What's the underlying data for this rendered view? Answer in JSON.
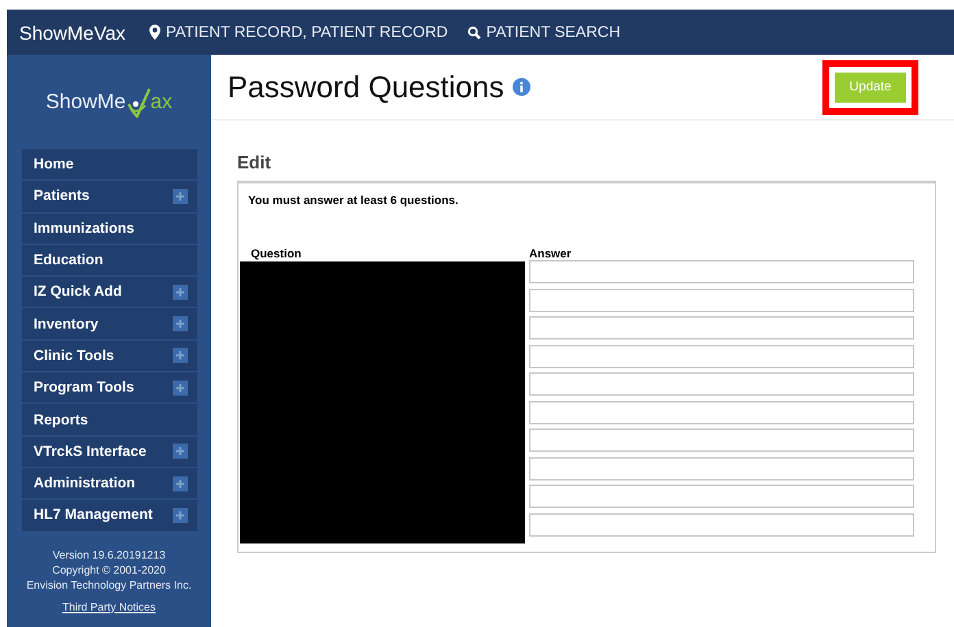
{
  "header": {
    "brand": "ShowMeVax",
    "location": "PATIENT RECORD, PATIENT RECORD",
    "search_link": "PATIENT SEARCH"
  },
  "sidebar": {
    "logo": {
      "text_before": "ShowMe",
      "text_after": "ax"
    },
    "items": [
      {
        "label": "Home",
        "expandable": false
      },
      {
        "label": "Patients",
        "expandable": true
      },
      {
        "label": "Immunizations",
        "expandable": false
      },
      {
        "label": "Education",
        "expandable": false
      },
      {
        "label": "IZ Quick Add",
        "expandable": true
      },
      {
        "label": "Inventory",
        "expandable": true
      },
      {
        "label": "Clinic Tools",
        "expandable": true
      },
      {
        "label": "Program Tools",
        "expandable": true
      },
      {
        "label": "Reports",
        "expandable": false
      },
      {
        "label": "VTrckS Interface",
        "expandable": true
      },
      {
        "label": "Administration",
        "expandable": true
      },
      {
        "label": "HL7 Management",
        "expandable": true
      }
    ],
    "footer": [
      "Version 19.6.20191213",
      "Copyright © 2001-2020",
      "Envision Technology Partners Inc."
    ],
    "notices_link": "Third Party Notices"
  },
  "page": {
    "title": "Password Questions",
    "update_button": {
      "label": "Update",
      "highlighted": true
    }
  },
  "edit": {
    "heading": "Edit",
    "message": "You must answer at least 6 questions.",
    "question_header": "Question",
    "answer_header": "Answer",
    "questions_redacted": true,
    "answers": [
      {
        "kind": "text"
      },
      {
        "kind": "text"
      },
      {
        "kind": "text"
      },
      {
        "kind": "text"
      },
      {
        "kind": "text"
      },
      {
        "kind": "text"
      },
      {
        "kind": "text"
      },
      {
        "kind": "text"
      },
      {
        "kind": "text"
      },
      {
        "kind": "text"
      }
    ]
  }
}
